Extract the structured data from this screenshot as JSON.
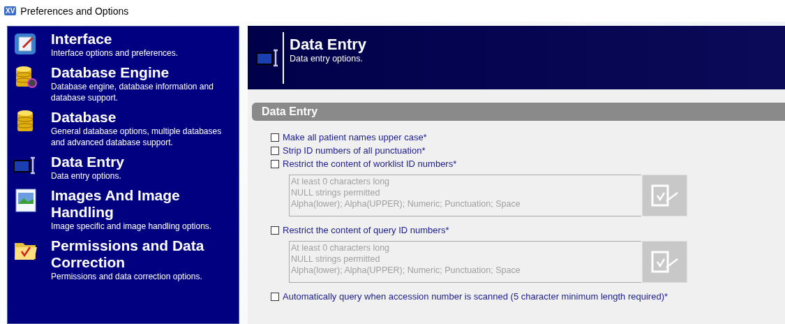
{
  "window": {
    "title": "Preferences and Options",
    "logo": "XV"
  },
  "sidebar": {
    "items": [
      {
        "title": "Interface",
        "description": "Interface options and preferences."
      },
      {
        "title": "Database Engine",
        "description": "Database engine, database information and database support."
      },
      {
        "title": "Database",
        "description": "General database options, multiple databases and advanced database support."
      },
      {
        "title": "Data Entry",
        "description": "Data entry options."
      },
      {
        "title": "Images And Image Handling",
        "description": "Image specific and image handling options."
      },
      {
        "title": "Permissions and Data Correction",
        "description": "Permissions and data correction options."
      }
    ]
  },
  "header": {
    "title": "Data Entry",
    "subtitle": "Data entry options."
  },
  "section": {
    "title": "Data Entry"
  },
  "options": [
    {
      "kind": "checkbox",
      "label": "Make all patient names upper case*",
      "checked": false
    },
    {
      "kind": "checkbox",
      "label": "Strip ID numbers of all punctuation*",
      "checked": false
    },
    {
      "kind": "rules",
      "label": "Restrict the content of worklist ID numbers*",
      "checked": false,
      "rules": [
        "At least 0 characters long",
        "NULL strings permitted",
        "Alpha(lower); Alpha(UPPER); Numeric; Punctuation; Space"
      ]
    },
    {
      "kind": "rules",
      "label": "Restrict the content of query ID numbers*",
      "checked": false,
      "rules": [
        "At least 0 characters long",
        "NULL strings permitted",
        "Alpha(lower); Alpha(UPPER); Numeric; Punctuation; Space"
      ]
    },
    {
      "kind": "checkbox",
      "label": "Automatically query when accession number is scanned (5 character minimum length required)*",
      "checked": false
    }
  ]
}
